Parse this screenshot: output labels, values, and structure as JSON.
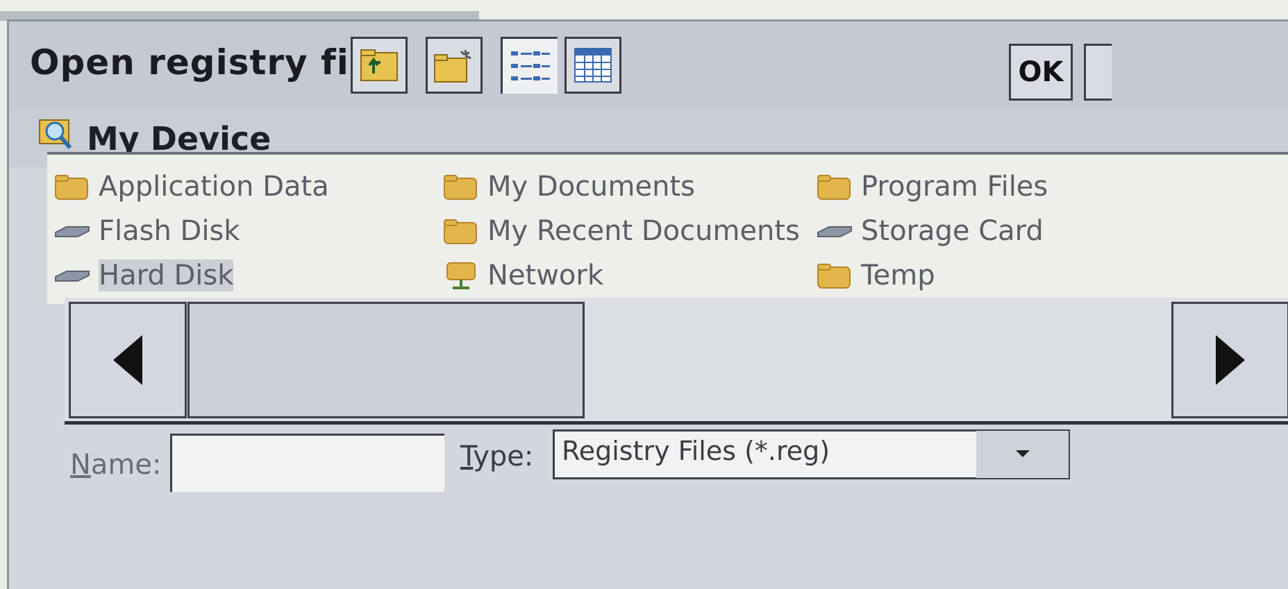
{
  "dialog": {
    "title": "Open registry file",
    "ok_label": "OK"
  },
  "toolbar": {
    "buttons": [
      {
        "icon": "up-folder-icon"
      },
      {
        "icon": "new-folder-icon"
      },
      {
        "icon": "list-view-icon"
      },
      {
        "icon": "details-view-icon"
      }
    ]
  },
  "location": {
    "label": "My Device",
    "icon": "search-folder-icon"
  },
  "files": {
    "columns": [
      [
        {
          "label": "Application Data",
          "icon": "folder-icon"
        },
        {
          "label": "Flash Disk",
          "icon": "drive-icon"
        },
        {
          "label": "Hard Disk",
          "icon": "drive-icon",
          "selected": true
        }
      ],
      [
        {
          "label": "My Documents",
          "icon": "folder-icon"
        },
        {
          "label": "My Recent Documents",
          "icon": "folder-icon"
        },
        {
          "label": "Network",
          "icon": "network-icon"
        }
      ],
      [
        {
          "label": "Program Files",
          "icon": "folder-icon"
        },
        {
          "label": "Storage Card",
          "icon": "drive-icon"
        },
        {
          "label": "Temp",
          "icon": "folder-icon"
        }
      ]
    ]
  },
  "form": {
    "name_label_first": "N",
    "name_label_rest": "ame:",
    "name_value": "",
    "type_label_first": "T",
    "type_label_rest": "ype:",
    "type_value": "Registry Files (*.reg)"
  },
  "colors": {
    "folder": "#e2b64a",
    "folder_dark": "#b5862a",
    "drive": "#8d96a6"
  }
}
